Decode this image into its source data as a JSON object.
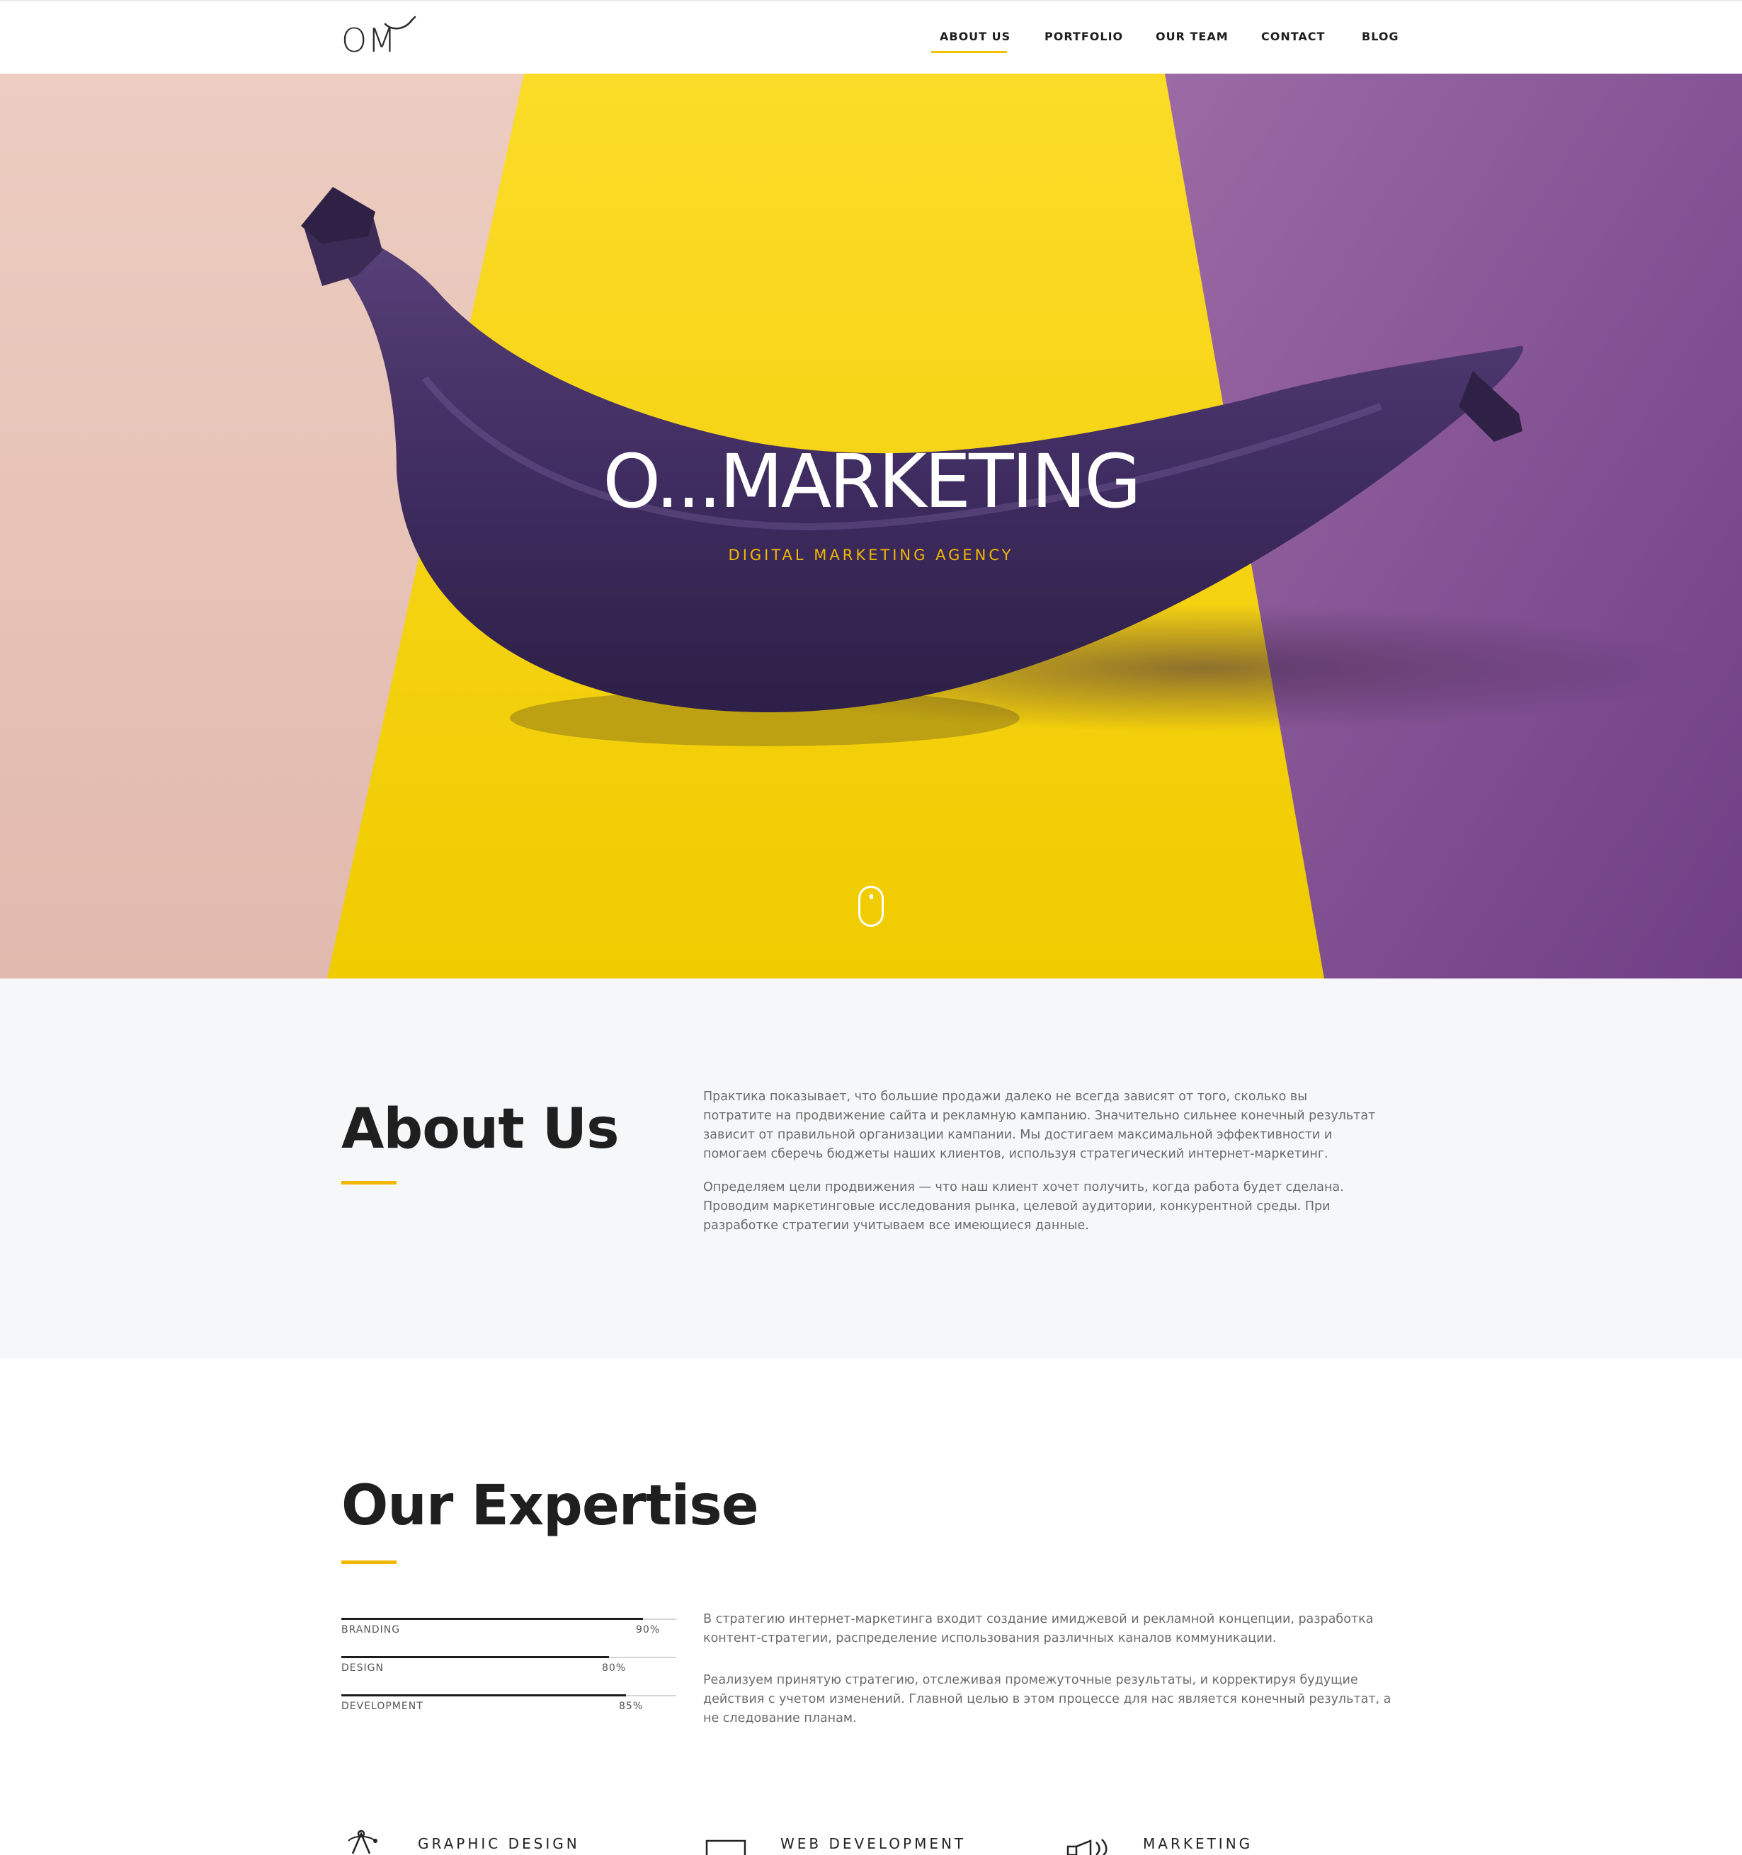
{
  "header": {
    "logo_text": "OM",
    "nav": [
      {
        "label": "ABOUT US",
        "active": true
      },
      {
        "label": "PORTFOLIO",
        "active": false
      },
      {
        "label": "OUR TEAM",
        "active": false
      },
      {
        "label": "CONTACT",
        "active": false
      },
      {
        "label": "BLOG",
        "active": false
      }
    ]
  },
  "hero": {
    "title": "O...MARKETING",
    "subtitle": "DIGITAL MARKETING AGENCY",
    "scroll_icon": "mouse-scroll-icon"
  },
  "about": {
    "title": "About Us",
    "paragraphs": [
      "Практика показывает, что большие продажи далеко не всегда зависят от того, сколько вы потратите на продвижение сайта и рекламную кампанию. Значительно сильнее конечный результат зависит от правильной организации кампании. Мы достигаем максимальной эффективности и помогаем сберечь бюджеты наших клиентов, используя стратегический интернет-маркетинг.",
      "Определяем цели продвижения — что наш клиент хочет получить, когда работа будет сделана. Проводим маркетинговые исследования рынка, целевой аудитории, конкурентной среды. При разработке стратегии учитываем все имеющиеся данные."
    ]
  },
  "expertise": {
    "title": "Our Expertise",
    "skills": [
      {
        "label": "BRANDING",
        "percent_text": "90%",
        "value": 0.9
      },
      {
        "label": "DESIGN",
        "percent_text": "80%",
        "value": 0.8
      },
      {
        "label": "DEVELOPMENT",
        "percent_text": "85%",
        "value": 0.85
      }
    ],
    "paragraphs": [
      "В стратегию интернет-маркетинга входит создание имиджевой и рекламной концепции, разработка контент-стратегии, распределение использования различных каналов коммуникации.",
      "Реализуем принятую стратегию, отслеживая промежуточные результаты, и корректируя будущие действия с учетом изменений. Главной целью в этом процессе для нас является конечный результат, а не следование планам."
    ]
  },
  "services": [
    {
      "title": "GRAPHIC DESIGN",
      "icon": "pen-tool-icon"
    },
    {
      "title": "WEB DEVELOPMENT",
      "icon": "monitor-icon"
    },
    {
      "title": "MARKETING",
      "icon": "megaphone-icon"
    }
  ],
  "colors": {
    "accent": "#f2b800",
    "hero_pink": "#e9c7bd",
    "hero_yellow": "#f2d300",
    "hero_purple": "#7d4a8c",
    "banana": "#3c2a5a"
  }
}
